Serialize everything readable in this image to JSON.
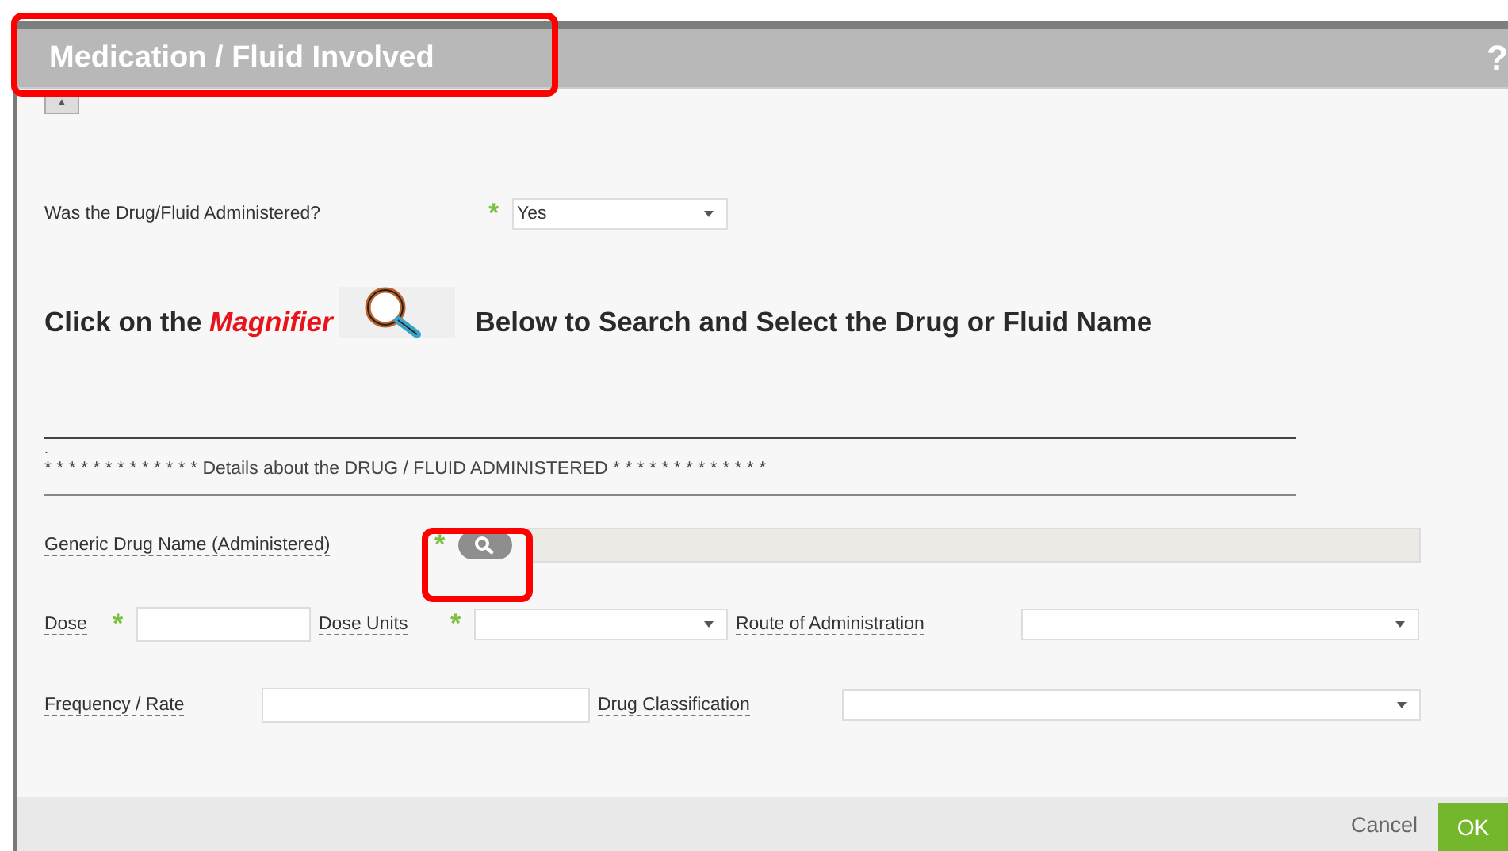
{
  "window": {
    "title": "Medication / Fluid Involved",
    "help": "?"
  },
  "collapse": {
    "glyph": "▲"
  },
  "question": {
    "label": "Was the Drug/Fluid Administered?",
    "required_mark": "*",
    "value": "Yes"
  },
  "instruction": {
    "before": "Click on the ",
    "emphasis": "Magnifier",
    "after": " Below to Search and Select the Drug or Fluid Name"
  },
  "section": {
    "dot": ".",
    "title": "* * * * * * * * * * * * * Details about the DRUG / FLUID ADMINISTERED * * * * * * * * * * * * *"
  },
  "fields": [
    {
      "label": "Generic Drug Name (Administered)",
      "required_mark": "*",
      "kind": "lookup"
    },
    {
      "label": "Dose",
      "required_mark": "*",
      "kind": "text"
    },
    {
      "label": "Dose Units",
      "required_mark": "*",
      "kind": "select"
    },
    {
      "label": "Route of Administration",
      "kind": "select"
    },
    {
      "label": "Frequency / Rate",
      "kind": "text"
    },
    {
      "label": "Drug Classification",
      "kind": "select"
    }
  ],
  "buttons": [
    {
      "label": "Cancel",
      "kind": "link"
    },
    {
      "label": "OK",
      "kind": "primary"
    }
  ]
}
